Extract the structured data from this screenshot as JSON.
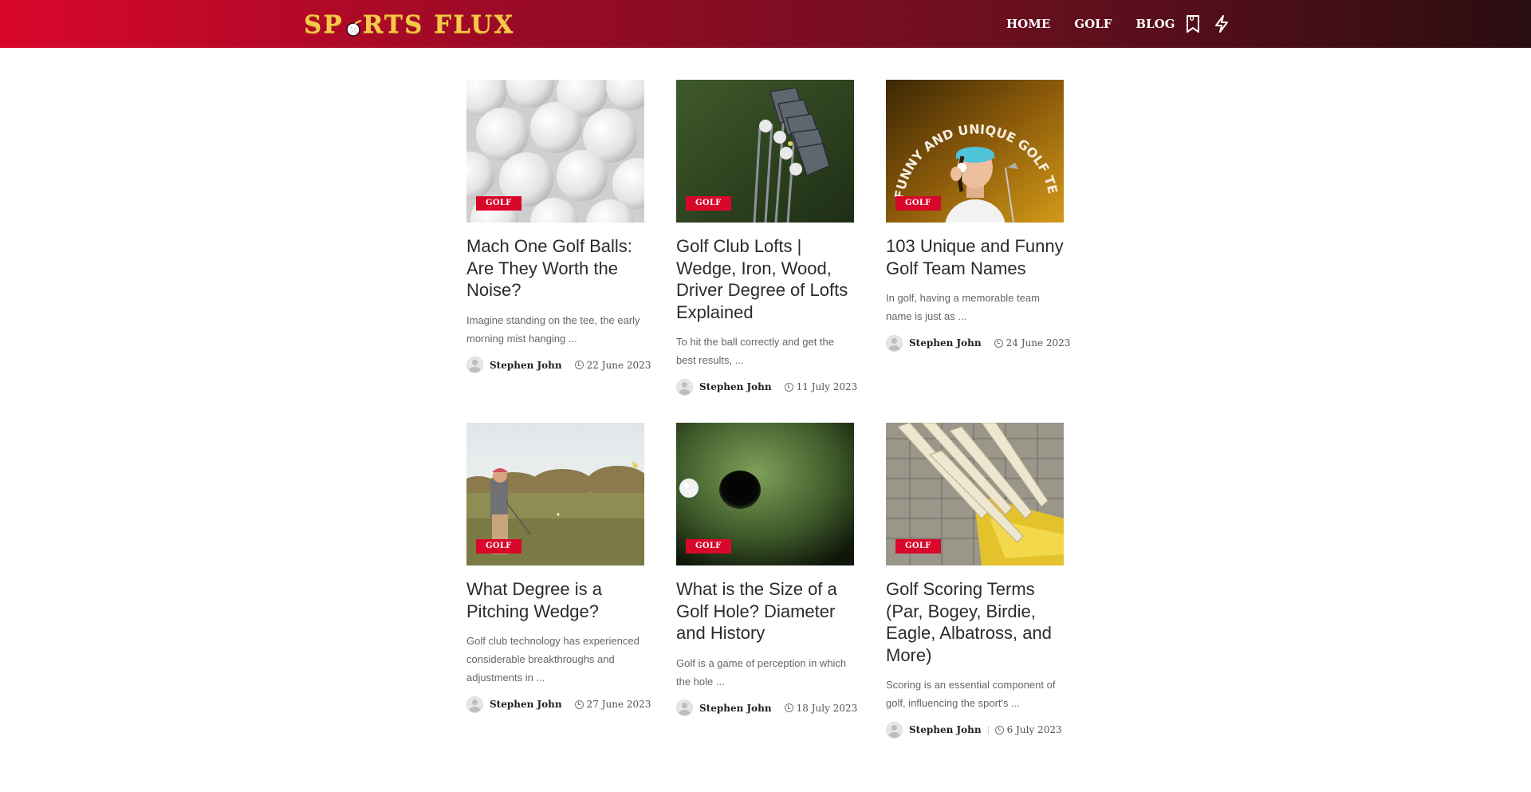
{
  "header": {
    "logo_text_1": "SP",
    "logo_text_2": "RTS FLUX",
    "nav": [
      "HOME",
      "GOLF",
      "BLOG"
    ],
    "bookmark_count": "0"
  },
  "colors": {
    "accent": "#d9072a",
    "logo": "#f7c948"
  },
  "posts": [
    {
      "category": "GOLF",
      "title": "Mach One Golf Balls: Are They Worth the Noise?",
      "excerpt": "Imagine standing on the tee, the early morning mist hanging ...",
      "author": "Stephen John",
      "date": "22 June 2023"
    },
    {
      "category": "GOLF",
      "title": "Golf Club Lofts | Wedge, Iron, Wood, Driver Degree of Lofts Explained",
      "excerpt": "To hit the ball correctly and get the best results, ...",
      "author": "Stephen John",
      "date": "11 July 2023"
    },
    {
      "category": "GOLF",
      "title": "103 Unique and Funny Golf Team Names",
      "excerpt": "In golf, having a memorable team name is just as ...",
      "author": "Stephen John",
      "date": "24 June 2023",
      "image_text": "FUNNY AND UNIQUE GOLF TEAM NAMES"
    },
    {
      "category": "GOLF",
      "title": "What Degree is a Pitching Wedge?",
      "excerpt": "Golf club technology has experienced considerable breakthroughs and adjustments in ...",
      "author": "Stephen John",
      "date": "27 June 2023"
    },
    {
      "category": "GOLF",
      "title": "What is the Size of a Golf Hole? Diameter and History",
      "excerpt": "Golf is a game of perception in which the hole ...",
      "author": "Stephen John",
      "date": "18 July 2023"
    },
    {
      "category": "GOLF",
      "title": "Golf Scoring Terms (Par, Bogey, Birdie, Eagle, Albatross, and More)",
      "excerpt": "Scoring is an essential component of golf, influencing the sport's ...",
      "author": "Stephen John",
      "date": "6 July 2023"
    }
  ]
}
